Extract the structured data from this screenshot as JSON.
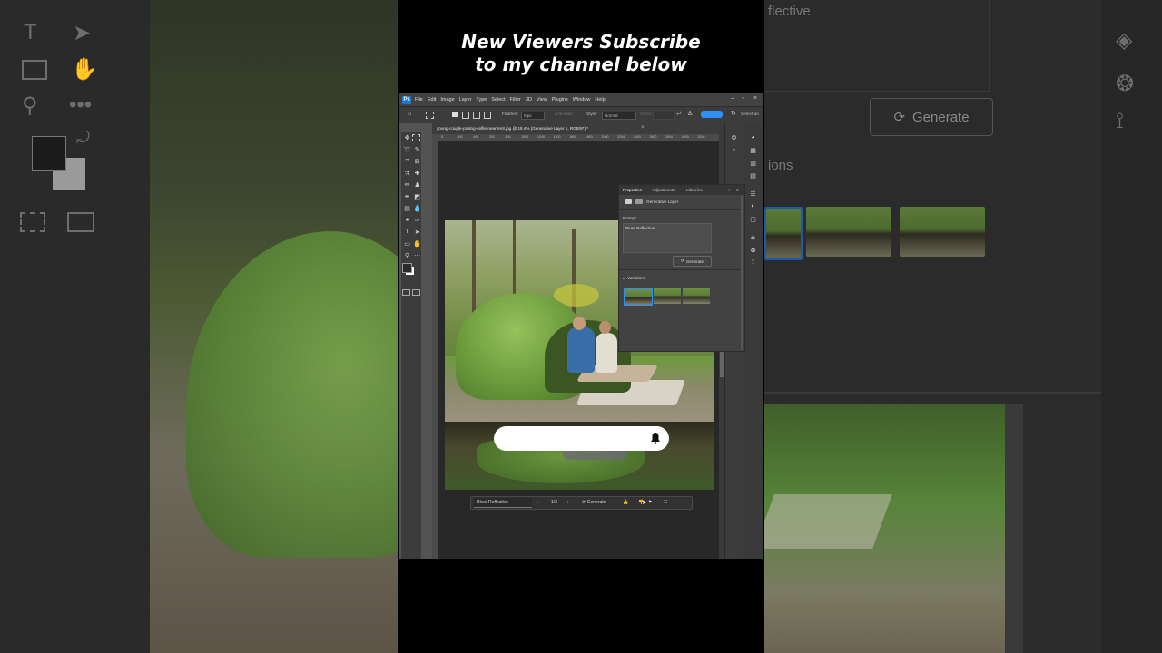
{
  "caption": {
    "line1": "New Viewers Subscribe",
    "line2": "to my channel below"
  },
  "backdrop": {
    "generate_label": "Generate",
    "prompt_fragment": "flective",
    "variations_fragment": "ions"
  },
  "ps": {
    "menu": [
      "File",
      "Edit",
      "Image",
      "Layer",
      "Type",
      "Select",
      "Filter",
      "3D",
      "View",
      "Plugins",
      "Window",
      "Help"
    ],
    "options": {
      "feather_label": "Feather:",
      "feather_value": "0 px",
      "antialias_label": "Anti-alias",
      "style_label": "Style:",
      "style_value": "Normal",
      "width_label": "Width:",
      "select_label": "Select an"
    },
    "document_tab": "young-couple-posing-selfie-near-tent.jpg @ 18.4% (Generative Layer 1, RGB/8*) *",
    "ruler_marks": [
      "5",
      "600",
      "400",
      "200",
      "800",
      "1000",
      "1200",
      "1400",
      "1600",
      "1800",
      "2000",
      "2200",
      "2400",
      "2600",
      "2800",
      "3000",
      "3200"
    ],
    "properties": {
      "tabs": [
        "Properties",
        "Adjustments",
        "Libraries"
      ],
      "layer_label": "Generative Layer",
      "prompt_label": "Prompt",
      "prompt_value": "River Reflective",
      "generate_label": "Generate",
      "variations_label": "Variations"
    },
    "taskbar": {
      "prompt_value": "River Reflective",
      "counter": "1/3",
      "generate_label": "Generate"
    }
  },
  "colors": {
    "accent": "#2f8ff5",
    "ps_dark": "#3c3c3c",
    "ps_canvas": "#282828"
  }
}
